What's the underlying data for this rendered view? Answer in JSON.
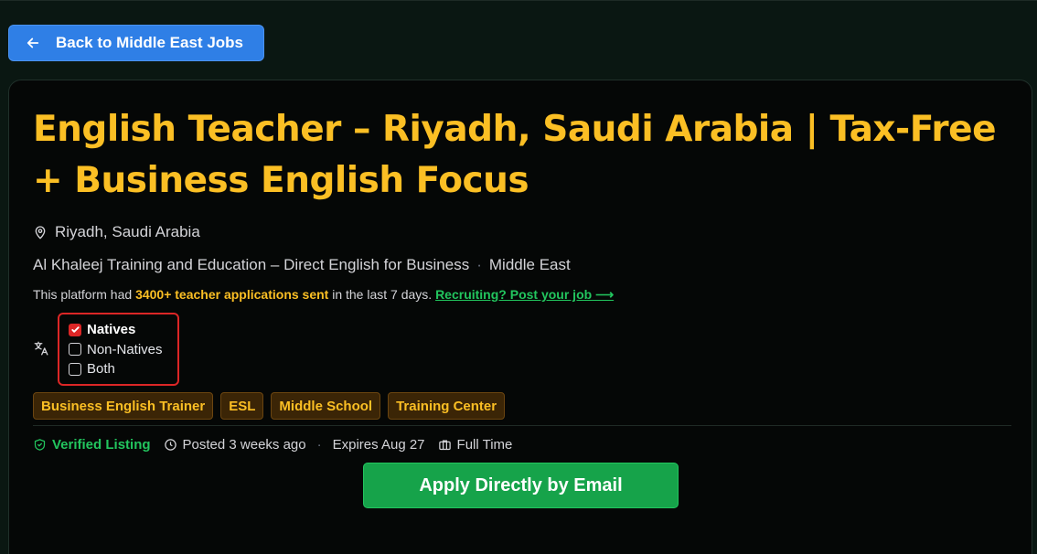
{
  "nav": {
    "back_label": "Back to Middle East Jobs"
  },
  "job": {
    "title": "English Teacher – Riyadh, Saudi Arabia | Tax-Free + Business English Focus",
    "location": "Riyadh, Saudi Arabia",
    "company": "Al Khaleej Training and Education – Direct English for Business",
    "company_sep": "·",
    "region": "Middle East"
  },
  "stats": {
    "prefix": "This platform had ",
    "highlight": "3400+ teacher applications sent",
    "suffix": " in the last 7 days. ",
    "link": "Recruiting? Post your job ⟶"
  },
  "language": {
    "options": [
      {
        "label": "Natives",
        "checked": true
      },
      {
        "label": "Non-Natives",
        "checked": false
      },
      {
        "label": "Both",
        "checked": false
      }
    ]
  },
  "tags": [
    "Business English Trainer",
    "ESL",
    "Middle School",
    "Training Center"
  ],
  "meta": {
    "verified": "Verified Listing",
    "posted": "Posted 3 weeks ago",
    "sep": "·",
    "expires": "Expires Aug 27",
    "type": "Full Time"
  },
  "apply_label": "Apply Directly by Email",
  "colors": {
    "accent": "#fbbf24",
    "primary": "#2f7fe6",
    "success": "#16a34a",
    "danger": "#dc2626"
  }
}
